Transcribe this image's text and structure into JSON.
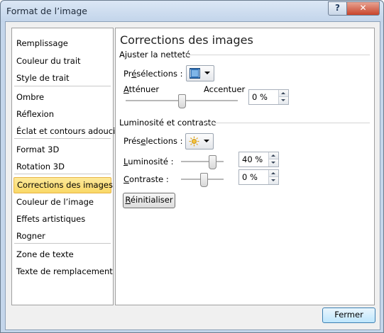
{
  "window": {
    "title": "Format de l’image",
    "help_label": "?",
    "close_label": "✕"
  },
  "nav": {
    "items": [
      "Remplissage",
      "Couleur du trait",
      "Style de trait",
      "Ombre",
      "Réflexion",
      "Éclat et contours adoucis",
      "Format 3D",
      "Rotation 3D",
      "Corrections des images",
      "Couleur de l’image",
      "Effets artistiques",
      "Rogner",
      "Zone de texte",
      "Texte de remplacement"
    ],
    "selected": "Corrections des images"
  },
  "panel": {
    "title": "Corrections des images",
    "sharpness": {
      "heading": "Ajuster la netteté",
      "presets_pre": "Pr",
      "presets_key": "é",
      "presets_post": "sélections :",
      "soften_key": "A",
      "soften_rest": "tténuer",
      "sharpen": "Accentuer",
      "value": "0 %",
      "level": 0
    },
    "brightness_contrast": {
      "heading": "Luminosité et contraste",
      "presets_pre": "Prés",
      "presets_key": "e",
      "presets_post": "lections :",
      "brightness_key": "L",
      "brightness_rest": "uminosité :",
      "brightness_value": "40 %",
      "brightness_level": 40,
      "contrast_key": "C",
      "contrast_rest": "ontraste :",
      "contrast_value": "0 %",
      "contrast_level": 0
    },
    "reset_key": "R",
    "reset_rest": "éinitialiser"
  },
  "footer": {
    "close_label": "Fermer"
  },
  "icons": {
    "sharpness_preset": "picture-preset-icon",
    "brightness_preset": "sun-preset-icon"
  },
  "colors": {
    "selection_bg": "#fbe18a",
    "selection_border": "#e8b547",
    "accent": "#3c7fb1"
  }
}
